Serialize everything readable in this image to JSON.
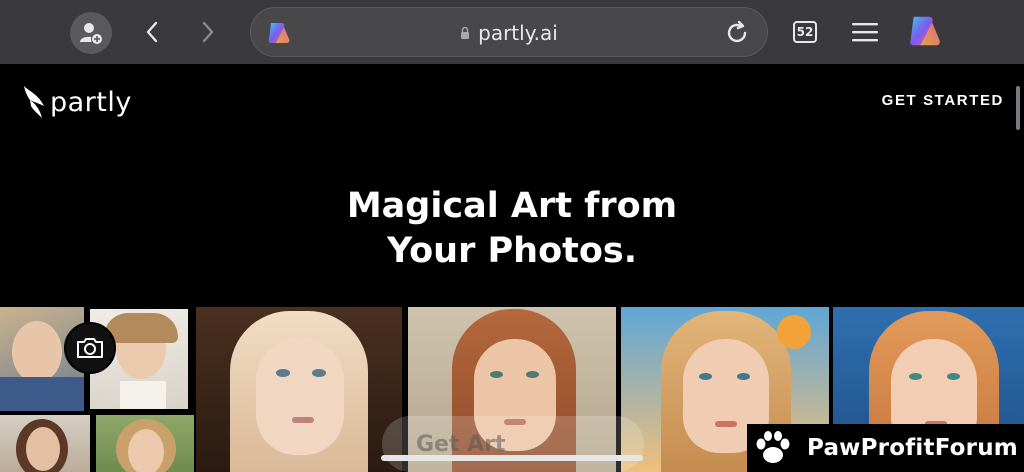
{
  "browser": {
    "url": "partly.ai",
    "tab_count": "52",
    "icons": [
      "add-profile-icon",
      "back-chevron-icon",
      "forward-chevron-icon",
      "copilot-icon",
      "lock-icon",
      "reload-icon",
      "tabs-icon",
      "hamburger-menu-icon",
      "copilot-icon"
    ]
  },
  "site": {
    "logo_text": "partly",
    "cta": "GET STARTED",
    "headline_line1": "Magical Art from",
    "headline_line2": "Your Photos."
  },
  "overlay_button_text": "Get Art",
  "watermark": {
    "text": "PawProfitForum",
    "icon": "paw-icon"
  },
  "colors": {
    "toolbar_bg": "#3a3a3c",
    "page_bg": "#000000",
    "text": "#ffffff"
  }
}
